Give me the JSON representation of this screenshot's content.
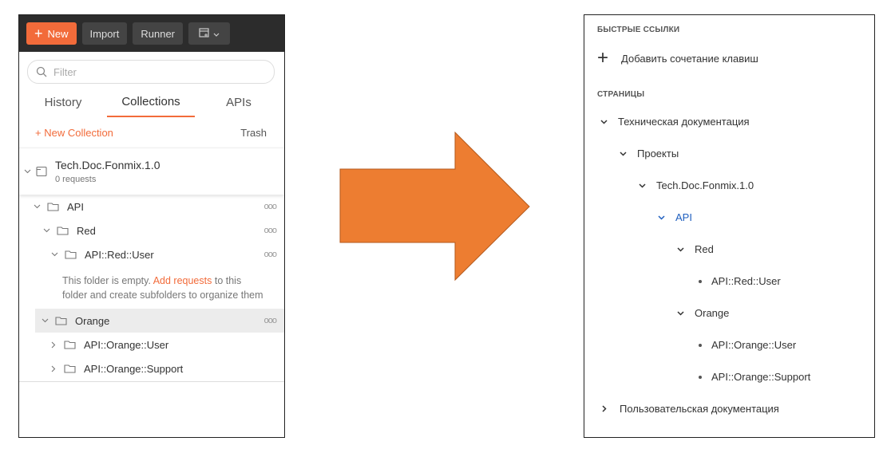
{
  "left_panel": {
    "toolbar": {
      "new_label": "New",
      "import_label": "Import",
      "runner_label": "Runner"
    },
    "filter_placeholder": "Filter",
    "tabs": [
      "History",
      "Collections",
      "APIs"
    ],
    "new_collection_label": "+ New Collection",
    "trash_label": "Trash",
    "collection": {
      "title": "Tech.Doc.Fonmix.1.0",
      "subtitle": "0 requests"
    },
    "folders": {
      "api": "API",
      "red": "Red",
      "red_user": "API::Red::User",
      "orange": "Orange",
      "orange_user": "API::Orange::User",
      "orange_support": "API::Orange::Support"
    },
    "empty_text_1": "This folder is empty. ",
    "empty_link": "Add requests",
    "empty_text_2": " to this",
    "empty_text_3": "folder and create subfolders to organize them",
    "more_glyph": "ooo"
  },
  "right_panel": {
    "section_shortcuts": "БЫСТРЫЕ ССЫЛКИ",
    "add_shortcut_label": "Добавить сочетание клавиш",
    "section_pages": "СТРАНИЦЫ",
    "tree": {
      "tech_docs": "Техническая документация",
      "projects": "Проекты",
      "tech_doc_fonmix": "Tech.Doc.Fonmix.1.0",
      "api": "API",
      "red": "Red",
      "red_user": "API::Red::User",
      "orange": "Orange",
      "orange_user": "API::Orange::User",
      "orange_support": "API::Orange::Support",
      "user_docs": "Пользовательская документация"
    }
  },
  "colors": {
    "accent": "#f26b3a",
    "arrow": "#ed7d31",
    "link_blue": "#1f5fbf",
    "toolbar_bg": "#2c2c2c"
  }
}
